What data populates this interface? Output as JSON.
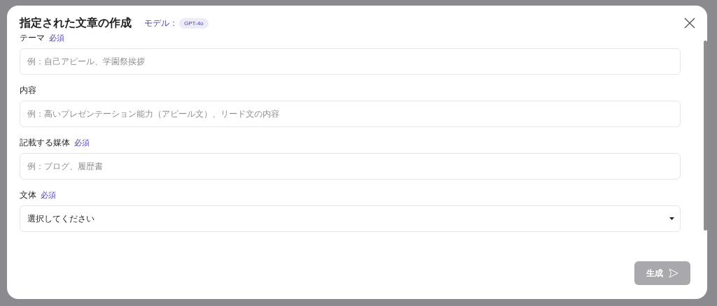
{
  "dialog": {
    "title": "指定された文章の作成",
    "model_label": "モデル：",
    "model_badge": "GPT-4o"
  },
  "fields": [
    {
      "kind": "input",
      "label": "テーマ",
      "required_text": "必須",
      "placeholder": "例：自己アピール、学園祭挨拶"
    },
    {
      "kind": "input",
      "label": "内容",
      "placeholder": "例：高いプレゼンテーション能力（アピール文）、リード文の内容"
    },
    {
      "kind": "input",
      "label": "記載する媒体",
      "required_text": "必須",
      "placeholder": "例：ブログ、履歴書"
    },
    {
      "kind": "select",
      "label": "文体",
      "required_text": "必須",
      "value": "選択してください"
    }
  ],
  "submit": {
    "label": "生成",
    "disabled": true
  }
}
